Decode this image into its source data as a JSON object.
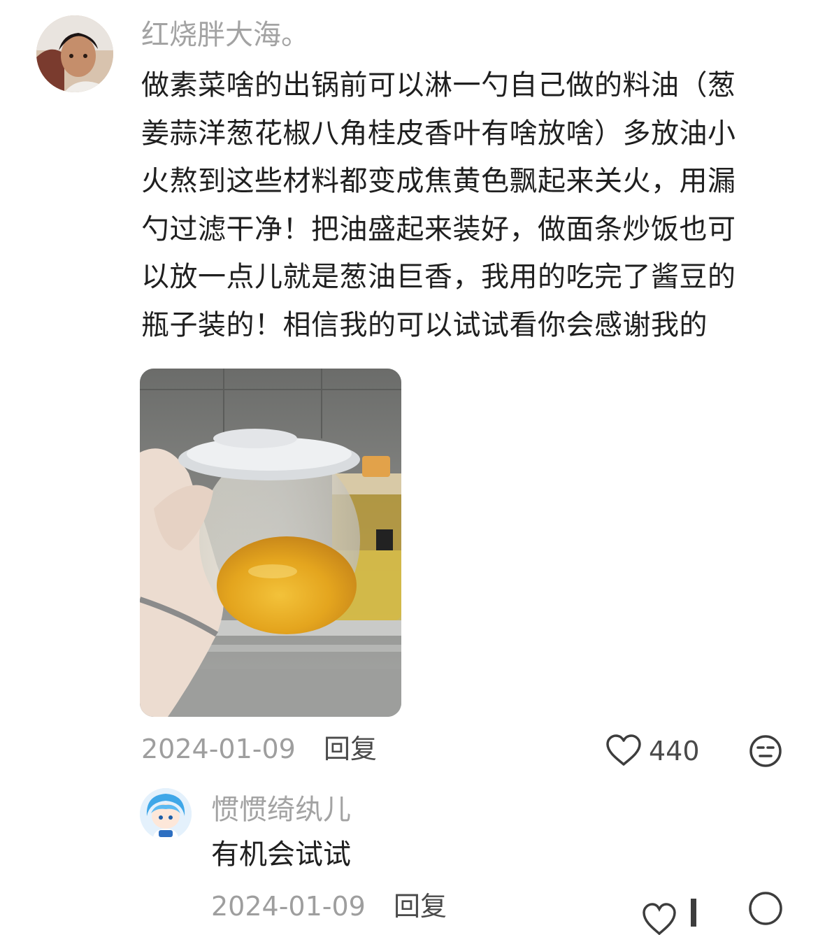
{
  "main_comment": {
    "username": "红烧胖大海。",
    "text_lines": [
      "做素菜啥的出锅前可以淋一勺自己做的料油（葱",
      "姜蒜洋葱花椒八角桂皮香叶有啥放啥）多放油小",
      "火熬到这些材料都变成焦黄色飘起来关火，用漏",
      "勺过滤干净！把油盛起来装好，做面条炒饭也可",
      "以放一点儿就是葱油巨香，我用的吃完了酱豆的",
      "瓶子装的！相信我的可以试试看你会感谢我的"
    ],
    "date": "2024-01-09",
    "reply_label": "回复",
    "like_count": "440"
  },
  "reply_comment": {
    "username": "惯惯绮纨儿",
    "text": "有机会试试",
    "date": "2024-01-09",
    "reply_label": "回复"
  },
  "icons": {
    "like": "heart-outline-icon",
    "dislike": "meh-face-icon"
  },
  "colors": {
    "username": "#a3a3a3",
    "text": "#1f1f1f",
    "meta": "#9e9e9e"
  }
}
